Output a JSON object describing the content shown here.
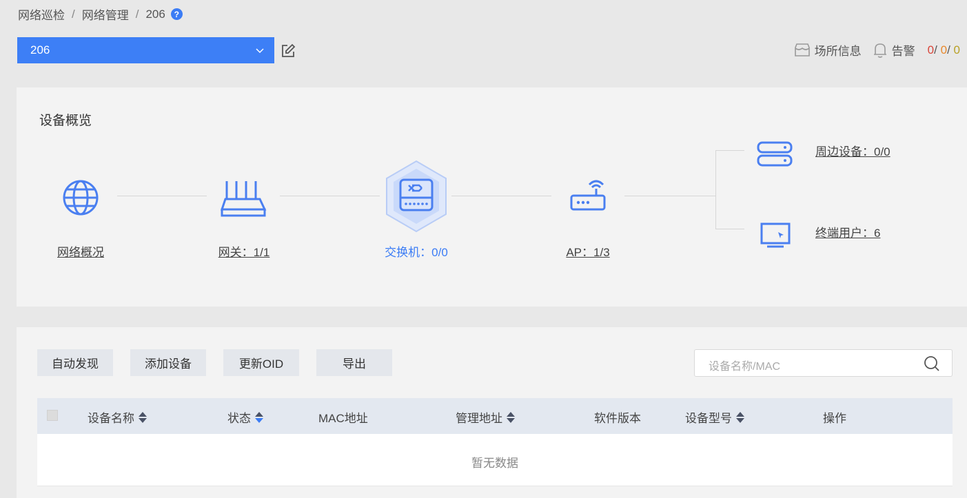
{
  "breadcrumb": [
    "网络巡检",
    "网络管理",
    "206"
  ],
  "breadcrumb_sep": "/",
  "help_glyph": "?",
  "site_select": {
    "value": "206"
  },
  "top_right": {
    "site_info": "场所信息",
    "alarm": "告警",
    "counts": {
      "red": "0",
      "orange": "0",
      "yellow": "0"
    },
    "sep": "/"
  },
  "overview": {
    "title": "设备概览",
    "nodes": {
      "network": "网络概况",
      "gateway": "网关：1/1",
      "switch": "交换机：0/0",
      "ap": "AP：1/3",
      "peripheral": "周边设备：0/0",
      "terminal": "终端用户：6"
    }
  },
  "toolbar": {
    "auto_discover": "自动发现",
    "add_device": "添加设备",
    "update_oid": "更新OID",
    "export": "导出"
  },
  "search": {
    "placeholder": "设备名称/MAC"
  },
  "table": {
    "columns": [
      "设备名称",
      "状态",
      "MAC地址",
      "管理地址",
      "软件版本",
      "设备型号",
      "操作"
    ],
    "empty": "暂无数据"
  },
  "colors": {
    "accent": "#3d7ff6",
    "icon_blue": "#4a7ff0",
    "count_red": "#d9453a",
    "count_orange": "#e8892d",
    "count_yellow": "#b8a125"
  }
}
